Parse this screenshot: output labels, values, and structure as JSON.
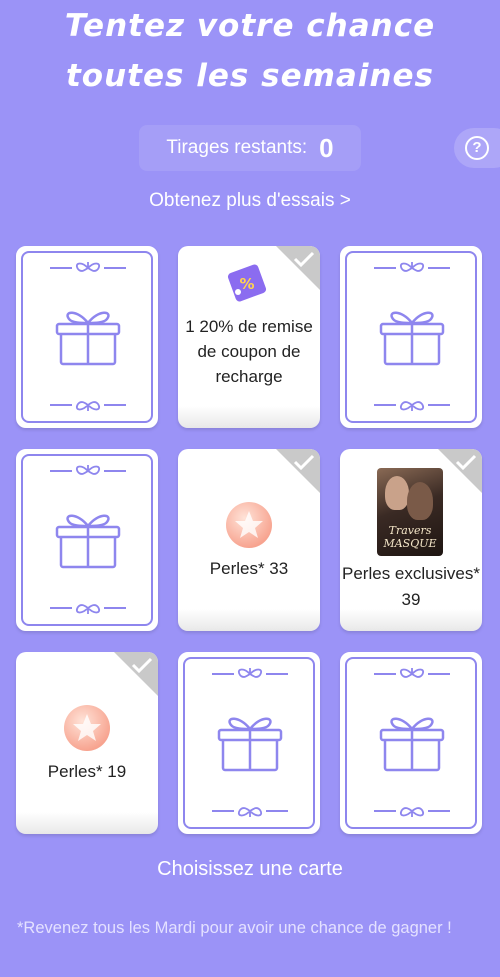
{
  "header": {
    "title_line1": "Tentez votre chance",
    "title_line2": "toutes les semaines"
  },
  "draws": {
    "label": "Tirages restants:",
    "count": "0"
  },
  "help_icon": "question-circle-icon",
  "more_tries_link": "Obtenez plus d'essais >",
  "cards": [
    {
      "state": "closed"
    },
    {
      "state": "revealed",
      "prize": "1 20% de remise de coupon de recharge",
      "icon": "coupon-icon"
    },
    {
      "state": "closed"
    },
    {
      "state": "closed"
    },
    {
      "state": "revealed",
      "prize": "Perles* 33",
      "icon": "pearl-icon"
    },
    {
      "state": "revealed",
      "prize": "Perles exclusives* 39",
      "icon": "book-cover",
      "book_title": "Travers MASQUE"
    },
    {
      "state": "revealed",
      "prize": "Perles* 19",
      "icon": "pearl-icon"
    },
    {
      "state": "closed"
    },
    {
      "state": "closed"
    }
  ],
  "choose_card_label": "Choisissez une carte",
  "footnote": "*Revenez tous les Mardi pour avoir une chance de gagner !",
  "colors": {
    "background": "#9b93f7",
    "card_border": "#8e86ee",
    "coupon": "#8b6cf0",
    "pearl": "#f7a38f"
  }
}
